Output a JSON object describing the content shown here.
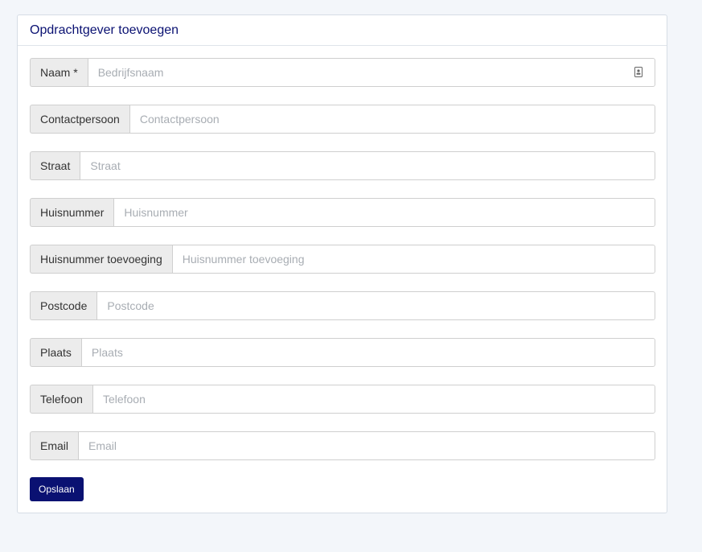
{
  "card": {
    "title": "Opdrachtgever toevoegen"
  },
  "form": {
    "fields": {
      "naam": {
        "label": "Naam *",
        "placeholder": "Bedrijfsnaam",
        "value": "",
        "icon": "contact-card-icon"
      },
      "contactpersoon": {
        "label": "Contactpersoon",
        "placeholder": "Contactpersoon",
        "value": ""
      },
      "straat": {
        "label": "Straat",
        "placeholder": "Straat",
        "value": ""
      },
      "huisnummer": {
        "label": "Huisnummer",
        "placeholder": "Huisnummer",
        "value": ""
      },
      "huisnummer_toevoeging": {
        "label": "Huisnummer toevoeging",
        "placeholder": "Huisnummer toevoeging",
        "value": ""
      },
      "postcode": {
        "label": "Postcode",
        "placeholder": "Postcode",
        "value": ""
      },
      "plaats": {
        "label": "Plaats",
        "placeholder": "Plaats",
        "value": ""
      },
      "telefoon": {
        "label": "Telefoon",
        "placeholder": "Telefoon",
        "value": ""
      },
      "email": {
        "label": "Email",
        "placeholder": "Email",
        "value": ""
      }
    },
    "submit_label": "Opslaan"
  },
  "colors": {
    "primary": "#0a1172",
    "page_background": "#f3f6fa",
    "addon_background": "#ececec"
  }
}
